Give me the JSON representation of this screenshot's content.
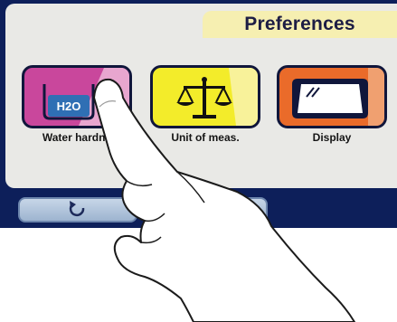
{
  "header": {
    "title": "Preferences"
  },
  "tiles": [
    {
      "label": "Water hardne",
      "icon": "water-hardness-icon",
      "icon_text": "H2O",
      "color": "#c9479c"
    },
    {
      "label": "Unit of meas.",
      "icon": "scales-icon",
      "color": "#f3ec2a"
    },
    {
      "label": "Display",
      "icon": "display-icon",
      "color": "#ea6b2a"
    }
  ],
  "nav": {
    "back_icon": "back-arrow-icon"
  },
  "colors": {
    "frame": "#0d1f5a",
    "panel": "#e9e9e6",
    "title_tab": "#f6efb1"
  }
}
